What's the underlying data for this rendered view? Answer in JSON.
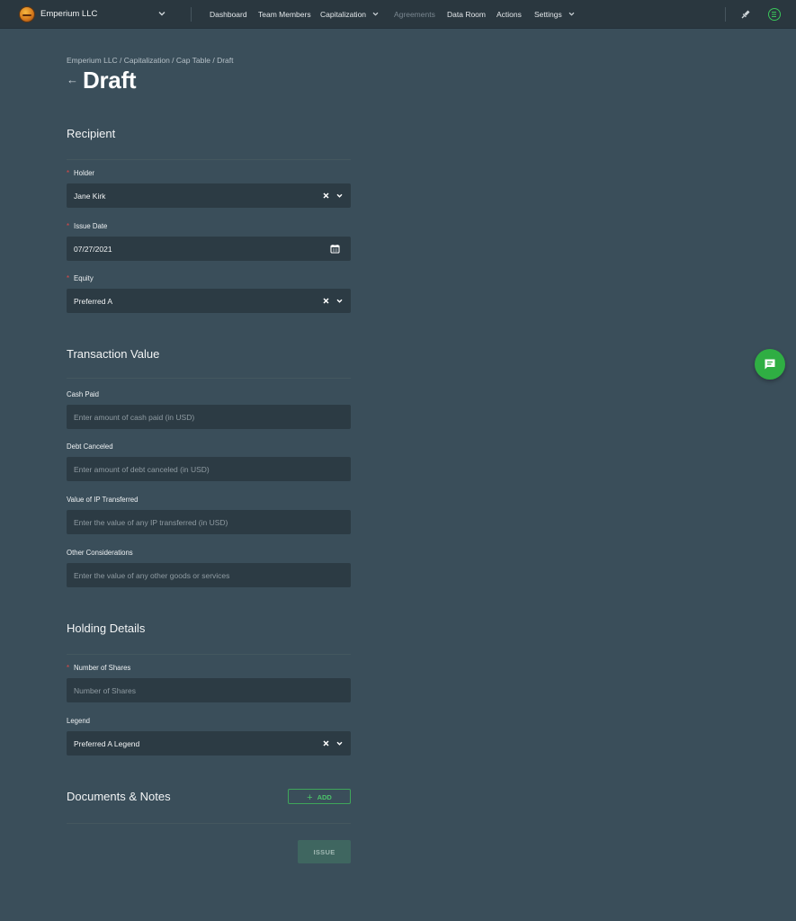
{
  "topbar": {
    "org_name": "Emperium LLC",
    "nav": [
      {
        "label": "Dashboard"
      },
      {
        "label": "Team Members"
      },
      {
        "label": "Capitalization"
      },
      {
        "label": "Agreements"
      },
      {
        "label": "Data Room"
      },
      {
        "label": "Actions"
      },
      {
        "label": "Settings"
      }
    ],
    "icons": [
      "chevron-down-icon",
      "rocket-icon",
      "brand-icon"
    ]
  },
  "header": {
    "breadcrumb": "Emperium LLC / Capitalization  / Cap Table / Draft",
    "title": "Draft",
    "back_icon": "arrow-left-icon"
  },
  "recipient": {
    "title": "Recipient",
    "holder": {
      "label": "Holder",
      "value": "Jane Kirk"
    },
    "issue_date": {
      "label": "Issue Date",
      "value": "07/27/2021"
    },
    "equity": {
      "label": "Equity",
      "value": "Preferred A"
    }
  },
  "transaction": {
    "title": "Transaction Value",
    "cash_paid": {
      "label": "Cash Paid",
      "placeholder": "Enter amount of cash paid (in USD)"
    },
    "debt_canceled": {
      "label": "Debt Canceled",
      "placeholder": "Enter amount of debt canceled (in USD)"
    },
    "ip_value": {
      "label": "Value of IP Transferred",
      "placeholder": "Enter the value of any IP transferred (in USD)"
    },
    "other": {
      "label": "Other Considerations",
      "placeholder": "Enter the value of any other goods or services"
    }
  },
  "holding": {
    "title": "Holding Details",
    "shares": {
      "label": "Number of Shares",
      "placeholder": "Number of Shares"
    },
    "legend": {
      "label": "Legend",
      "value": "Preferred A Legend"
    }
  },
  "documents": {
    "title": "Documents & Notes",
    "add_label": "ADD"
  },
  "actions": {
    "issue_label": "ISSUE"
  },
  "colors": {
    "background": "#3a4e5a",
    "topbar": "#2a373f",
    "field": "#2c3b44",
    "accent_green": "#3ac45a",
    "required": "#e04848"
  }
}
